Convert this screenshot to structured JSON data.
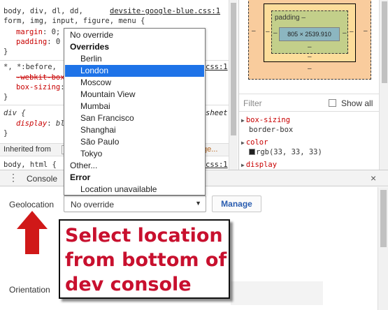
{
  "styles": {
    "rules": [
      {
        "selector_line1": "body, div, dl, dd,",
        "source": "devsite-google-blue.css:1",
        "selector_line2": "form, img, input, figure, menu {",
        "props": [
          {
            "name": "margin",
            "value": "0;"
          },
          {
            "name": "padding",
            "value": "0"
          }
        ],
        "close": "}"
      },
      {
        "selector": "*, *:before,",
        "source": "css:1",
        "props": [
          {
            "name": "-webkit-box",
            "value": ""
          },
          {
            "name": "box-sizing",
            "value": ""
          }
        ],
        "close": "}"
      },
      {
        "selector": "div {",
        "source": "sheet",
        "props": [
          {
            "name": "display",
            "value": "bl"
          }
        ],
        "close": "}"
      },
      {
        "selector": "body, html {",
        "source": "css:1"
      }
    ],
    "inherited_label": "Inherited from",
    "inherited_tail": "ge..."
  },
  "box_model": {
    "padding_label": "padding –",
    "content_size": "805 × 2539.910",
    "dash": "–"
  },
  "computed": {
    "filter_placeholder": "Filter",
    "show_all_label": "Show all",
    "props": [
      {
        "name": "box-sizing",
        "value": "border-box"
      },
      {
        "name": "color",
        "value": "rgb(33, 33, 33)",
        "swatch": "#212121"
      },
      {
        "name": "display",
        "value": ""
      }
    ]
  },
  "drawer": {
    "menu_icon": "⋮",
    "tab_label": "Console",
    "close_icon": "×",
    "geolocation_label": "Geolocation",
    "geolocation_value": "No override",
    "manage_label": "Manage",
    "orientation_label": "Orientation"
  },
  "dropdown": {
    "items": [
      {
        "label": "No override",
        "kind": "top"
      },
      {
        "label": "Overrides",
        "kind": "group"
      },
      {
        "label": "Berlin",
        "kind": "child"
      },
      {
        "label": "London",
        "kind": "child",
        "selected": true
      },
      {
        "label": "Moscow",
        "kind": "child"
      },
      {
        "label": "Mountain View",
        "kind": "child"
      },
      {
        "label": "Mumbai",
        "kind": "child"
      },
      {
        "label": "San Francisco",
        "kind": "child"
      },
      {
        "label": "Shanghai",
        "kind": "child"
      },
      {
        "label": "São Paulo",
        "kind": "child"
      },
      {
        "label": "Tokyo",
        "kind": "child"
      },
      {
        "label": "Other...",
        "kind": "top"
      },
      {
        "label": "Error",
        "kind": "group"
      },
      {
        "label": "Location unavailable",
        "kind": "child"
      }
    ]
  },
  "annotation": {
    "text": "Select location from bottom of dev console",
    "text_color": "#c8102e",
    "arrow_color": "#d01818"
  }
}
